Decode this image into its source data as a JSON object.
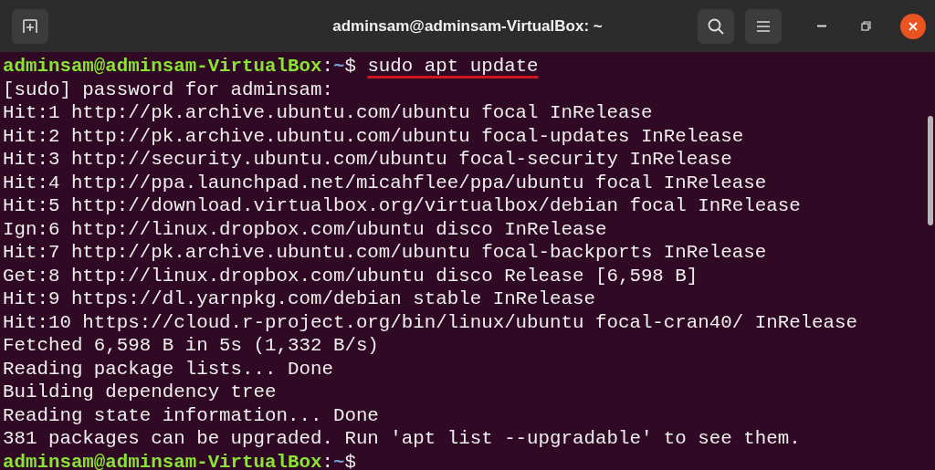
{
  "window": {
    "title": "adminsam@adminsam-VirtualBox: ~"
  },
  "terminal": {
    "lines": [
      {
        "kind": "prompt",
        "user_host": "adminsam@adminsam-VirtualBox",
        "separator": ":",
        "path": "~",
        "symbol": "$",
        "command": "sudo apt update",
        "underlined": true
      },
      {
        "kind": "output",
        "text": "[sudo] password for adminsam:"
      },
      {
        "kind": "output",
        "text": "Hit:1 http://pk.archive.ubuntu.com/ubuntu focal InRelease"
      },
      {
        "kind": "output",
        "text": "Hit:2 http://pk.archive.ubuntu.com/ubuntu focal-updates InRelease"
      },
      {
        "kind": "output",
        "text": "Hit:3 http://security.ubuntu.com/ubuntu focal-security InRelease"
      },
      {
        "kind": "output",
        "text": "Hit:4 http://ppa.launchpad.net/micahflee/ppa/ubuntu focal InRelease"
      },
      {
        "kind": "output",
        "text": "Hit:5 http://download.virtualbox.org/virtualbox/debian focal InRelease"
      },
      {
        "kind": "output",
        "text": "Ign:6 http://linux.dropbox.com/ubuntu disco InRelease"
      },
      {
        "kind": "output",
        "text": "Hit:7 http://pk.archive.ubuntu.com/ubuntu focal-backports InRelease"
      },
      {
        "kind": "output",
        "text": "Get:8 http://linux.dropbox.com/ubuntu disco Release [6,598 B]"
      },
      {
        "kind": "output",
        "text": "Hit:9 https://dl.yarnpkg.com/debian stable InRelease"
      },
      {
        "kind": "output",
        "text": "Hit:10 https://cloud.r-project.org/bin/linux/ubuntu focal-cran40/ InRelease"
      },
      {
        "kind": "output",
        "text": "Fetched 6,598 B in 5s (1,332 B/s)"
      },
      {
        "kind": "output",
        "text": "Reading package lists... Done"
      },
      {
        "kind": "output",
        "text": "Building dependency tree"
      },
      {
        "kind": "output",
        "text": "Reading state information... Done"
      },
      {
        "kind": "output",
        "text": "381 packages can be upgraded. Run 'apt list --upgradable' to see them."
      },
      {
        "kind": "prompt",
        "user_host": "adminsam@adminsam-VirtualBox",
        "separator": ":",
        "path": "~",
        "symbol": "$"
      }
    ]
  }
}
